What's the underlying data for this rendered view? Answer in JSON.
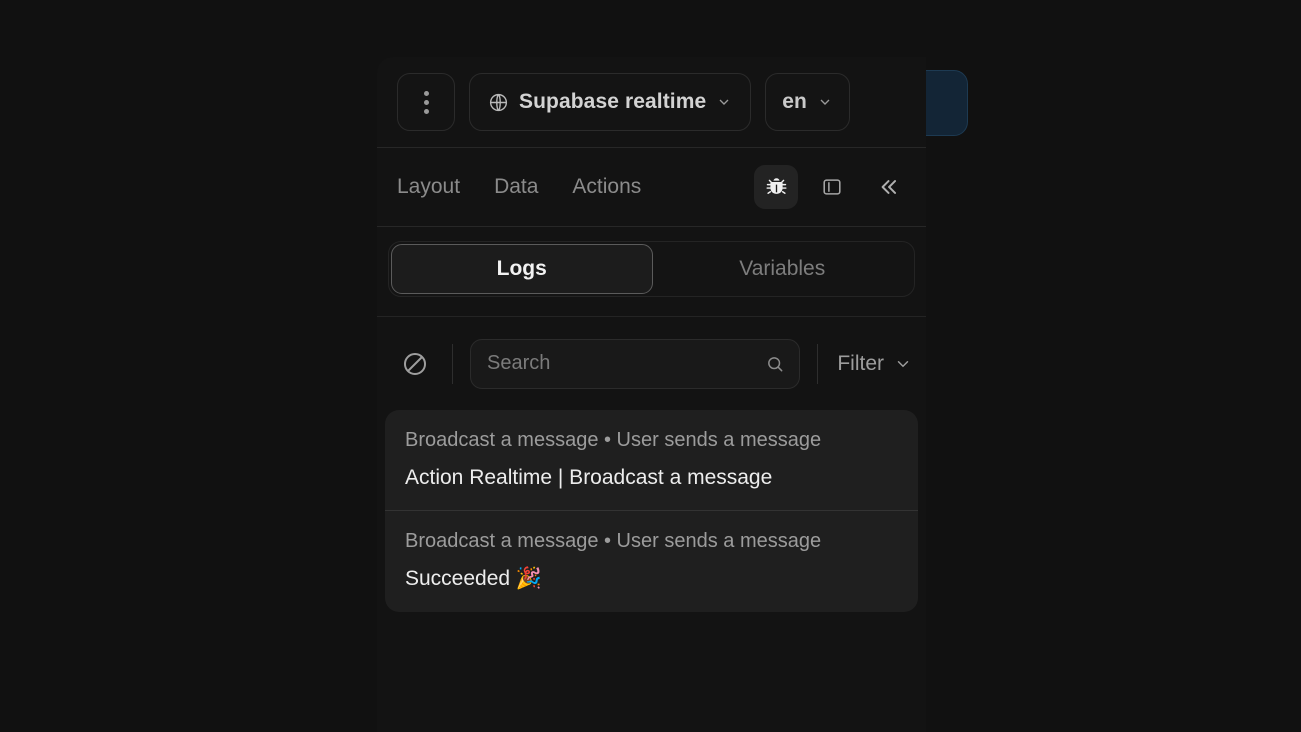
{
  "header": {
    "menu_icon": "kebab-menu-icon",
    "project": {
      "icon": "globe-icon",
      "label": "Supabase realtime",
      "chevron": "chevron-down-icon"
    },
    "language": {
      "label": "en",
      "chevron": "chevron-down-icon"
    }
  },
  "nav": {
    "tabs": [
      {
        "label": "Layout"
      },
      {
        "label": "Data"
      },
      {
        "label": "Actions"
      }
    ],
    "tools": [
      {
        "name": "bug-icon",
        "active": true
      },
      {
        "name": "panel-left-icon",
        "active": false
      },
      {
        "name": "chevrons-left-icon",
        "active": false
      }
    ]
  },
  "segmented": {
    "tabs": [
      {
        "label": "Logs",
        "active": true
      },
      {
        "label": "Variables",
        "active": false
      }
    ]
  },
  "toolbar": {
    "clear_icon": "ban-circle-slash-icon",
    "search": {
      "value": "",
      "placeholder": "Search",
      "icon": "search-icon"
    },
    "filter": {
      "label": "Filter",
      "chevron": "chevron-down-icon"
    }
  },
  "logs": {
    "entries": [
      {
        "meta": "Broadcast a message • User sends a message",
        "message": "Action Realtime | Broadcast a message"
      },
      {
        "meta": "Broadcast a message • User sends a message",
        "message": "Succeeded 🎉"
      }
    ]
  },
  "colors": {
    "page_bg": "#111111",
    "panel_bg": "#131313",
    "log_bg": "#1f1f1f",
    "accent_edge": "#132536",
    "text_primary": "#ededed",
    "text_muted": "#9c9c9c"
  }
}
